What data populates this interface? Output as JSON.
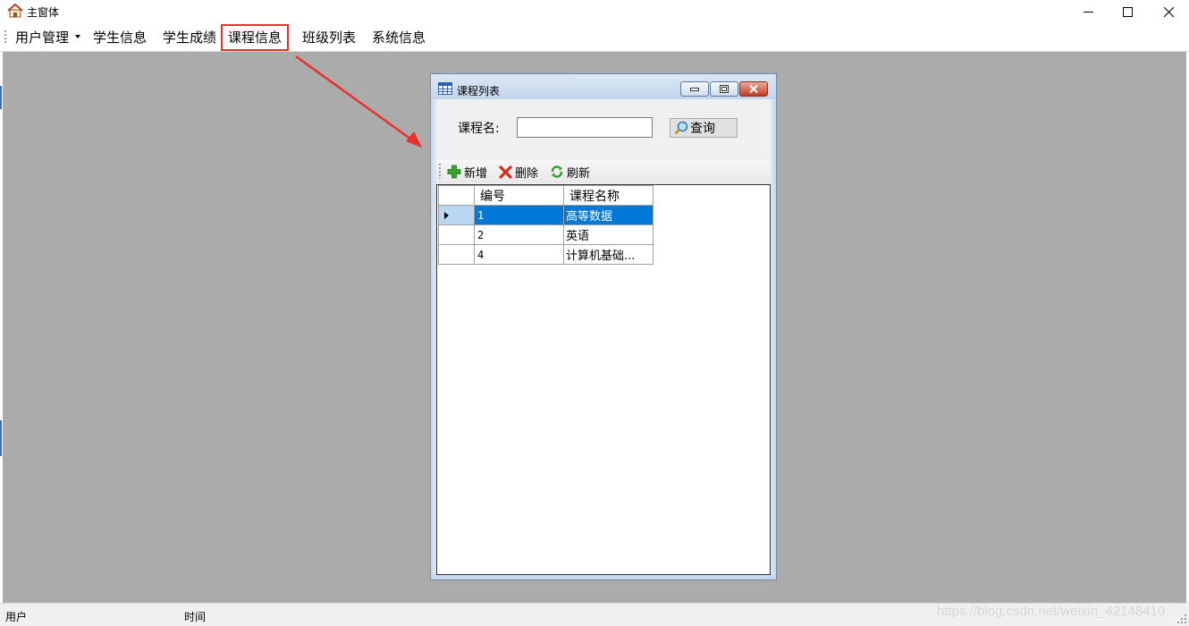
{
  "window": {
    "title": "主窗体"
  },
  "menu": [
    {
      "label": "用户管理",
      "has_dropdown": true
    },
    {
      "label": "学生信息"
    },
    {
      "label": "学生成绩"
    },
    {
      "label": "课程信息",
      "highlighted": true
    },
    {
      "label": "班级列表"
    },
    {
      "label": "系统信息"
    }
  ],
  "child_window": {
    "title": "课程列表",
    "search": {
      "label": "课程名:",
      "value": "",
      "button_label": "查询"
    },
    "toolbar": {
      "add": "新增",
      "delete": "删除",
      "refresh": "刷新"
    },
    "grid": {
      "columns": [
        "编号",
        "课程名称"
      ],
      "rows": [
        {
          "id": "1",
          "name": "高等数据",
          "selected": true
        },
        {
          "id": "2",
          "name": "英语"
        },
        {
          "id": "4",
          "name": "计算机基础..."
        }
      ]
    }
  },
  "status": {
    "user_label": "用户",
    "time_label": "时间",
    "watermark": "https://blog.csdn.net/weixin_42148410"
  },
  "colors": {
    "highlight_border": "#e8322b",
    "arrow": "#e8322b",
    "selection": "#0078d7",
    "mdi_background": "#ababab"
  }
}
